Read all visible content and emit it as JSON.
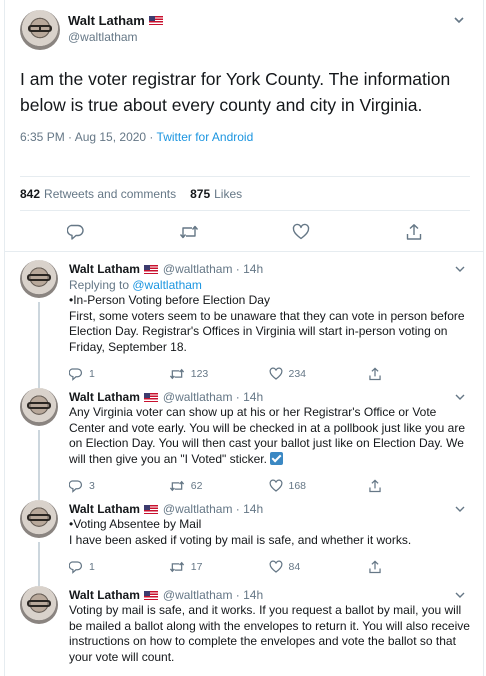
{
  "main_tweet": {
    "name": "Walt Latham",
    "handle": "@waltlatham",
    "text": "I am the voter registrar for York County. The information below is true about every county and city in Virginia.",
    "time": "6:35 PM · Aug 15, 2020 · ",
    "source": "Twitter for Android",
    "retweets_count": "842",
    "retweets_label": "Retweets and comments",
    "likes_count": "875",
    "likes_label": "Likes"
  },
  "replies": [
    {
      "name": "Walt Latham",
      "handle": "@waltlatham · 14h",
      "replying_prefix": "Replying to ",
      "replying_to": "@waltlatham",
      "text": "•In-Person Voting before Election Day\nFirst, some voters seem to be unaware that they can vote in person before Election Day. Registrar's Offices in Virginia will start in-person voting on Friday, September 18.",
      "replies": "1",
      "retweets": "123",
      "likes": "234"
    },
    {
      "name": "Walt Latham",
      "handle": "@waltlatham · 14h",
      "text": "Any Virginia voter can show up at his or her Registrar's Office or Vote Center and vote early. You will be checked in at a pollbook just like you are on Election Day. You will then cast your ballot just like on Election Day. We will then give you an \"I Voted\" sticker.",
      "replies": "3",
      "retweets": "62",
      "likes": "168"
    },
    {
      "name": "Walt Latham",
      "handle": "@waltlatham · 14h",
      "text": "•Voting Absentee by Mail\nI have been asked if voting by mail is safe, and whether it works.",
      "replies": "1",
      "retweets": "17",
      "likes": "84"
    },
    {
      "name": "Walt Latham",
      "handle": "@waltlatham · 14h",
      "text": "Voting by mail is safe, and it works. If you request a ballot by mail, you will be mailed a ballot along with the envelopes to return it. You will also receive instructions on how to complete the envelopes and vote the ballot so that your vote will count."
    }
  ],
  "colors": {
    "accent": "#1b95e0",
    "secondary_text": "#657786",
    "divider": "#e6ecf0",
    "thread_line": "#ccd6dd"
  }
}
